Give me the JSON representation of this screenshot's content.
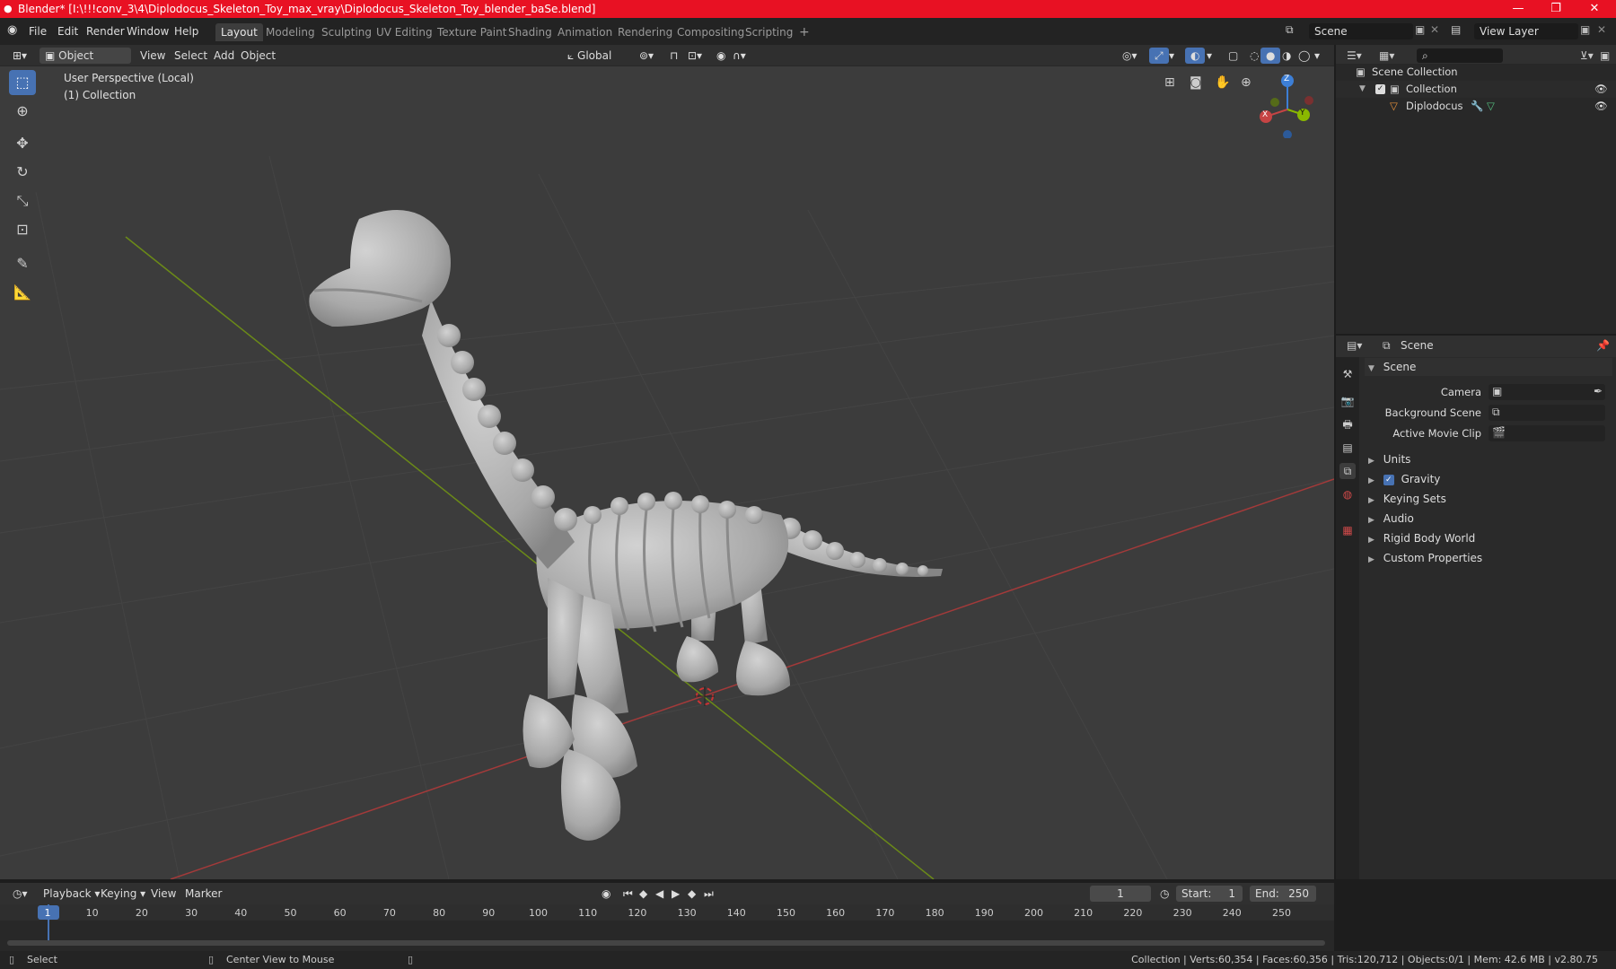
{
  "window": {
    "title": "Blender* [I:\\!!!conv_3\\4\\Diplodocus_Skeleton_Toy_max_vray\\Diplodocus_Skeleton_Toy_blender_baSe.blend]",
    "minimize": "—",
    "maximize": "❐",
    "close": "✕"
  },
  "menu": {
    "items": [
      "File",
      "Edit",
      "Render",
      "Window",
      "Help"
    ]
  },
  "workspaces": [
    "Layout",
    "Modeling",
    "Sculpting",
    "UV Editing",
    "Texture Paint",
    "Shading",
    "Animation",
    "Rendering",
    "Compositing",
    "Scripting",
    "+"
  ],
  "active_workspace": "Layout",
  "scene_field": "Scene",
  "view_layer_field": "View Layer",
  "viewport_header": {
    "mode": "Object Mode",
    "menus": [
      "View",
      "Select",
      "Add",
      "Object"
    ],
    "transform_orientation": "Global"
  },
  "viewport": {
    "perspective_label": "User Perspective (Local)",
    "collection_label": "(1) Collection",
    "gizmo": {
      "z": "Z",
      "y": "Y",
      "x": "X"
    }
  },
  "outliner": {
    "rows": [
      {
        "label": "Scene Collection"
      },
      {
        "label": "Collection"
      },
      {
        "label": "Diplodocus"
      }
    ]
  },
  "properties": {
    "header_title": "Scene",
    "panel_title": "Scene",
    "fields": [
      {
        "label": "Camera",
        "value": ""
      },
      {
        "label": "Background Scene",
        "value": ""
      },
      {
        "label": "Active Movie Clip",
        "value": ""
      }
    ],
    "sections": [
      "Units",
      "Gravity",
      "Keying Sets",
      "Audio",
      "Rigid Body World",
      "Custom Properties"
    ],
    "gravity_checked": true
  },
  "timeline": {
    "menus": [
      "Playback",
      "Keying",
      "View",
      "Marker"
    ],
    "current_frame": "1",
    "start_label": "Start:",
    "start_value": "1",
    "end_label": "End:",
    "end_value": "250",
    "ticks": [
      "1",
      "10",
      "20",
      "30",
      "40",
      "50",
      "60",
      "70",
      "80",
      "90",
      "100",
      "110",
      "120",
      "130",
      "140",
      "150",
      "160",
      "170",
      "180",
      "190",
      "200",
      "210",
      "220",
      "230",
      "240",
      "250"
    ]
  },
  "statusbar": {
    "left": "Select",
    "middle": "Center View to Mouse",
    "right": "Collection | Verts:60,354 | Faces:60,356 | Tris:120,712 | Objects:0/1 | Mem: 42.6 MB | v2.80.75"
  },
  "colors": {
    "titlebar": "#e81123",
    "accent": "#4772b3",
    "x_axis": "#c64444",
    "y_axis": "#8ab800",
    "z_axis": "#3d7fd6"
  }
}
